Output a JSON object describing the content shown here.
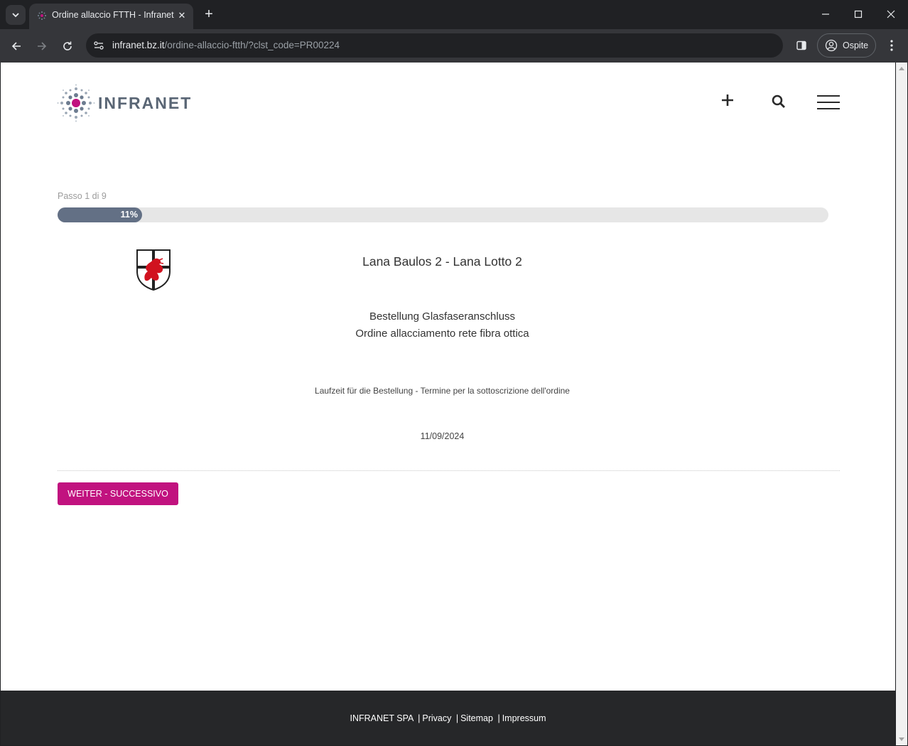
{
  "browser": {
    "tab_title": "Ordine allaccio FTTH - Infranet",
    "url_host": "infranet.bz.it",
    "url_path": "/ordine-allaccio-ftth/?clst_code=PR00224",
    "profile_label": "Ospite"
  },
  "header": {
    "logo_text": "INFRANET"
  },
  "progress": {
    "step_label": "Passo 1 di 9",
    "percent_label": "11%",
    "fraction": 0.11
  },
  "main": {
    "lot_title": "Lana Baulos 2 - Lana Lotto 2",
    "subtitle_de": "Bestellung Glasfaseranschluss",
    "subtitle_it": "Ordine allacciamento rete fibra ottica",
    "term_label": "Laufzeit für die Bestellung - Termine per la sottoscrizione dell'ordine",
    "term_date": "11/09/2024",
    "next_button": "WEITER - SUCCESSIVO"
  },
  "footer": {
    "company": "INFRANET SPA",
    "privacy": "Privacy",
    "sitemap": "Sitemap",
    "impressum": "Impressum",
    "separator": "|"
  },
  "colors": {
    "accent": "#c1127f",
    "progress_fill": "#637085",
    "footer_bg": "#262729"
  }
}
